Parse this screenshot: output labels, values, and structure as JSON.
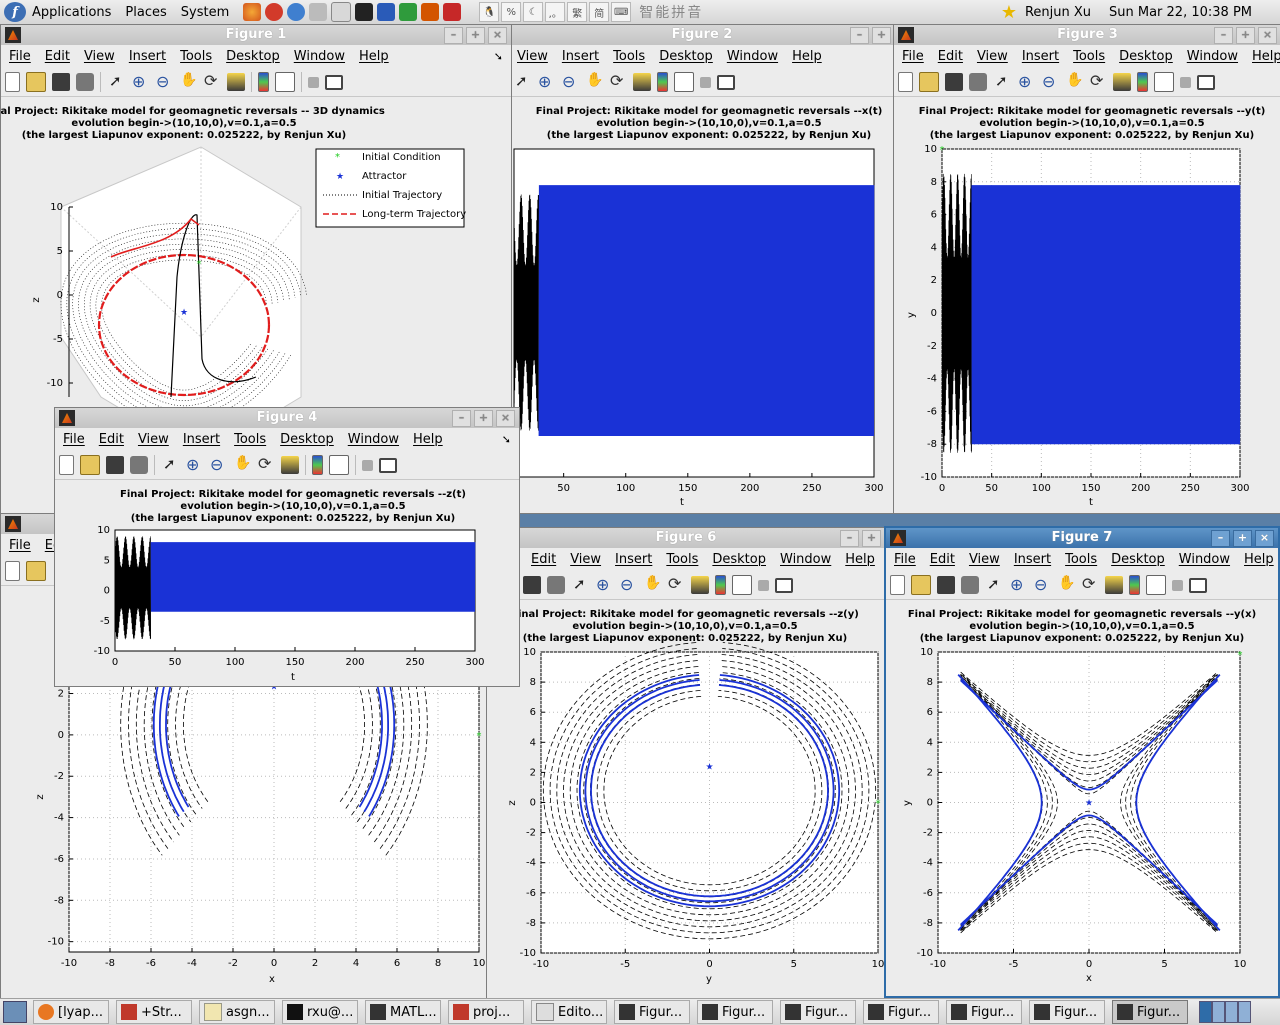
{
  "top_panel": {
    "menus": [
      "Applications",
      "Places",
      "System"
    ],
    "ime_text": "智能拼音",
    "user": "Renjun Xu",
    "datetime": "Sun Mar 22, 10:38 PM"
  },
  "menu_labels": [
    "File",
    "Edit",
    "View",
    "Insert",
    "Tools",
    "Desktop",
    "Window",
    "Help"
  ],
  "windows": {
    "fig1": {
      "title": "Figure 1",
      "title_lines": [
        "Final Project: Rikitake model for geomagnetic reversals -- 3D dynamics",
        "evolution begin->(10,10,0),v=0.1,a=0.5",
        "(the largest Liapunov exponent: 0.025222, by Renjun Xu)"
      ],
      "zlabel": "z",
      "ztick_labels": [
        "10",
        "5",
        "0",
        "-5",
        "-10"
      ],
      "legend": [
        "Initial Condition",
        "Attractor",
        "Initial Trajectory",
        "Long-term Trajectory"
      ]
    },
    "fig2": {
      "title": "Figure 2",
      "title_lines": [
        "Final Project: Rikitake model for geomagnetic reversals --x(t)",
        "evolution begin->(10,10,0),v=0.1,a=0.5",
        "(the largest Liapunov exponent: 0.025222, by Renjun Xu)"
      ],
      "xlabel": "t",
      "xtick_labels": [
        "50",
        "100",
        "150",
        "200",
        "250",
        "300"
      ]
    },
    "fig3": {
      "title": "Figure 3",
      "title_lines": [
        "Final Project: Rikitake model for geomagnetic reversals --y(t)",
        "evolution begin->(10,10,0),v=0.1,a=0.5",
        "(the largest Liapunov exponent: 0.025222, by Renjun Xu)"
      ],
      "xlabel": "t",
      "ylabel": "y",
      "xtick_labels": [
        "0",
        "50",
        "100",
        "150",
        "200",
        "250",
        "300"
      ],
      "ytick_labels": [
        "10",
        "8",
        "6",
        "4",
        "2",
        "0",
        "-2",
        "-4",
        "-6",
        "-8",
        "-10"
      ]
    },
    "fig4": {
      "title": "Figure 4",
      "title_lines": [
        "Final Project: Rikitake model for geomagnetic reversals --z(t)",
        "evolution begin->(10,10,0),v=0.1,a=0.5",
        "(the largest Liapunov exponent: 0.025222, by Renjun Xu)"
      ],
      "xlabel": "t",
      "xtick_labels": [
        "0",
        "50",
        "100",
        "150",
        "200",
        "250",
        "300"
      ],
      "ytick_labels": [
        "10",
        "5",
        "0",
        "-5",
        "-10"
      ]
    },
    "fig5": {
      "xlabel": "x",
      "ylabel": "z",
      "xtick_labels": [
        "-10",
        "-8",
        "-6",
        "-4",
        "-2",
        "0",
        "2",
        "4",
        "6",
        "8",
        "10"
      ],
      "ytick_labels": [
        "6",
        "4",
        "2",
        "0",
        "-2",
        "-4",
        "-6",
        "-8",
        "-10"
      ]
    },
    "fig6": {
      "title": "Figure 6",
      "title_lines": [
        "Final Project: Rikitake model for geomagnetic reversals --z(y)",
        "evolution begin->(10,10,0),v=0.1,a=0.5",
        "(the largest Liapunov exponent: 0.025222, by Renjun Xu)"
      ],
      "xlabel": "y",
      "ylabel": "z",
      "xtick_labels": [
        "-10",
        "-5",
        "0",
        "5",
        "10"
      ],
      "ytick_labels": [
        "10",
        "8",
        "6",
        "4",
        "2",
        "0",
        "-2",
        "-4",
        "-6",
        "-8",
        "-10"
      ]
    },
    "fig7": {
      "title": "Figure 7",
      "title_lines": [
        "Final Project: Rikitake model for geomagnetic reversals --y(x)",
        "evolution begin->(10,10,0),v=0.1,a=0.5",
        "(the largest Liapunov exponent: 0.025222, by Renjun Xu)"
      ],
      "xlabel": "x",
      "ylabel": "y",
      "xtick_labels": [
        "-10",
        "-5",
        "0",
        "5",
        "10"
      ],
      "ytick_labels": [
        "10",
        "8",
        "6",
        "4",
        "2",
        "0",
        "-2",
        "-4",
        "-6",
        "-8",
        "-10"
      ]
    }
  },
  "colors": {
    "long_term": "#1a32d6",
    "initial": "#000000",
    "trajectory_3d": "#e11d1d",
    "initial_condition": "#22cc22",
    "active_title": "#3b72ab"
  },
  "taskbar": [
    "[lyap...",
    "+Str...",
    "asgn...",
    "rxu@...",
    "MATL...",
    "proj...",
    "Edito...",
    "Figur...",
    "Figur...",
    "Figur...",
    "Figur...",
    "Figur...",
    "Figur...",
    "Figur..."
  ],
  "chart_data": [
    {
      "type": "line",
      "title": "Final Project: Rikitake model for geomagnetic reversals -- 3D dynamics",
      "series": [
        {
          "name": "Initial Condition"
        },
        {
          "name": "Attractor"
        },
        {
          "name": "Initial Trajectory"
        },
        {
          "name": "Long-term Trajectory"
        }
      ],
      "zlabel": "z",
      "zlim": [
        -10,
        10
      ]
    },
    {
      "type": "line",
      "title": "Final Project: Rikitake model for geomagnetic reversals --x(t)",
      "xlabel": "t",
      "xlim": [
        0,
        300
      ]
    },
    {
      "type": "line",
      "title": "Final Project: Rikitake model for geomagnetic reversals --y(t)",
      "xlabel": "t",
      "ylabel": "y",
      "xlim": [
        0,
        300
      ],
      "ylim": [
        -10,
        10
      ],
      "transient_end_t": 30,
      "oscillation_range": [
        -8,
        7.8
      ]
    },
    {
      "type": "line",
      "title": "Final Project: Rikitake model for geomagnetic reversals --z(t)",
      "xlabel": "t",
      "xlim": [
        0,
        300
      ],
      "ylim": [
        -10,
        10
      ],
      "transient_end_t": 30,
      "oscillation_range": [
        -3.5,
        8
      ]
    },
    {
      "type": "line",
      "xlabel": "x",
      "ylabel": "z",
      "xlim": [
        -10,
        10
      ]
    },
    {
      "type": "line",
      "title": "Final Project: Rikitake model for geomagnetic reversals --z(y)",
      "xlabel": "y",
      "ylabel": "z",
      "xlim": [
        -10,
        10
      ],
      "ylim": [
        -10,
        10
      ],
      "attractor_point": [
        0,
        2.2
      ],
      "initial_point": [
        10,
        0
      ]
    },
    {
      "type": "line",
      "title": "Final Project: Rikitake model for geomagnetic reversals --y(x)",
      "xlabel": "x",
      "ylabel": "y",
      "xlim": [
        -10,
        10
      ],
      "ylim": [
        -10,
        10
      ],
      "attractor_point": [
        0,
        0
      ],
      "initial_point": [
        10,
        10
      ]
    }
  ]
}
